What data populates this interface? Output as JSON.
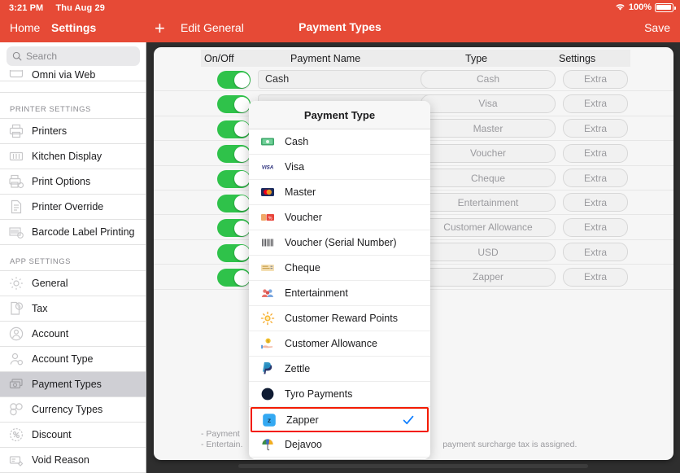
{
  "status_bar": {
    "time": "3:21 PM",
    "date": "Thu Aug 29",
    "battery_percent": "100%",
    "wifi_icon": "wifi-icon",
    "battery_icon": "battery-icon"
  },
  "nav": {
    "home": "Home",
    "settings": "Settings",
    "add_icon": "plus-icon",
    "edit": "Edit",
    "general": "General",
    "title": "Payment Types",
    "save": "Save",
    "accent_color": "#e64a36"
  },
  "search": {
    "placeholder": "Search",
    "icon": "search-icon"
  },
  "sidebar": {
    "clipped_item": {
      "label": "Omni via Web",
      "icon": "web-icon"
    },
    "sections": [
      {
        "header": "PRINTER SETTINGS",
        "items": [
          {
            "label": "Printers",
            "icon": "printer-icon",
            "selected": false
          },
          {
            "label": "Kitchen Display",
            "icon": "kitchen-display-icon",
            "selected": false
          },
          {
            "label": "Print Options",
            "icon": "print-options-icon",
            "selected": false
          },
          {
            "label": "Printer Override",
            "icon": "printer-override-icon",
            "selected": false
          },
          {
            "label": "Barcode Label Printing",
            "icon": "barcode-icon",
            "selected": false
          }
        ]
      },
      {
        "header": "APP SETTINGS",
        "items": [
          {
            "label": "General",
            "icon": "gear-icon",
            "selected": false
          },
          {
            "label": "Tax",
            "icon": "tax-icon",
            "selected": false
          },
          {
            "label": "Account",
            "icon": "account-icon",
            "selected": false
          },
          {
            "label": "Account Type",
            "icon": "account-type-icon",
            "selected": false
          },
          {
            "label": "Payment Types",
            "icon": "payment-types-icon",
            "selected": true
          },
          {
            "label": "Currency Types",
            "icon": "currency-types-icon",
            "selected": false
          },
          {
            "label": "Discount",
            "icon": "discount-icon",
            "selected": false
          },
          {
            "label": "Void Reason",
            "icon": "void-reason-icon",
            "selected": false
          }
        ]
      }
    ]
  },
  "table": {
    "columns": {
      "on_off": "On/Off",
      "payment_name": "Payment Name",
      "type": "Type",
      "settings": "Settings"
    },
    "extra_label": "Extra",
    "rows": [
      {
        "enabled": true,
        "name": "Cash",
        "type": "Cash",
        "settings": "Extra"
      },
      {
        "enabled": true,
        "name": "",
        "type": "Visa",
        "settings": "Extra"
      },
      {
        "enabled": true,
        "name": "",
        "type": "Master",
        "settings": "Extra"
      },
      {
        "enabled": true,
        "name": "",
        "type": "Voucher",
        "settings": "Extra"
      },
      {
        "enabled": true,
        "name": "",
        "type": "Cheque",
        "settings": "Extra"
      },
      {
        "enabled": true,
        "name": "",
        "type": "Entertainment",
        "settings": "Extra"
      },
      {
        "enabled": true,
        "name": "",
        "type": "Customer Allowance",
        "settings": "Extra"
      },
      {
        "enabled": true,
        "name": "",
        "type": "USD",
        "settings": "Extra"
      },
      {
        "enabled": true,
        "name": "",
        "type": "Zapper",
        "settings": "Extra"
      }
    ],
    "footnote_line1": "- Payment",
    "footnote_line2": "- Entertain.",
    "footnote_tail": "payment surcharge tax is assigned."
  },
  "popover": {
    "title": "Payment Type",
    "highlight_color": "#f31b00",
    "check_color": "#0a7cff",
    "items": [
      {
        "label": "Cash",
        "icon": "cash-icon",
        "selected": false
      },
      {
        "label": "Visa",
        "icon": "visa-icon",
        "selected": false
      },
      {
        "label": "Master",
        "icon": "mastercard-icon",
        "selected": false
      },
      {
        "label": "Voucher",
        "icon": "voucher-ticket-icon",
        "selected": false
      },
      {
        "label": "Voucher (Serial Number)",
        "icon": "barcode-icon",
        "selected": false
      },
      {
        "label": "Cheque",
        "icon": "cheque-icon",
        "selected": false
      },
      {
        "label": "Entertainment",
        "icon": "entertainment-icon",
        "selected": false
      },
      {
        "label": "Customer Reward Points",
        "icon": "reward-points-icon",
        "selected": false
      },
      {
        "label": "Customer Allowance",
        "icon": "customer-allowance-icon",
        "selected": false
      },
      {
        "label": "Zettle",
        "icon": "zettle-icon",
        "selected": false
      },
      {
        "label": "Tyro Payments",
        "icon": "tyro-icon",
        "selected": false
      },
      {
        "label": "Zapper",
        "icon": "zapper-icon",
        "selected": true
      },
      {
        "label": "Dejavoo",
        "icon": "dejavoo-icon",
        "selected": false
      }
    ]
  }
}
